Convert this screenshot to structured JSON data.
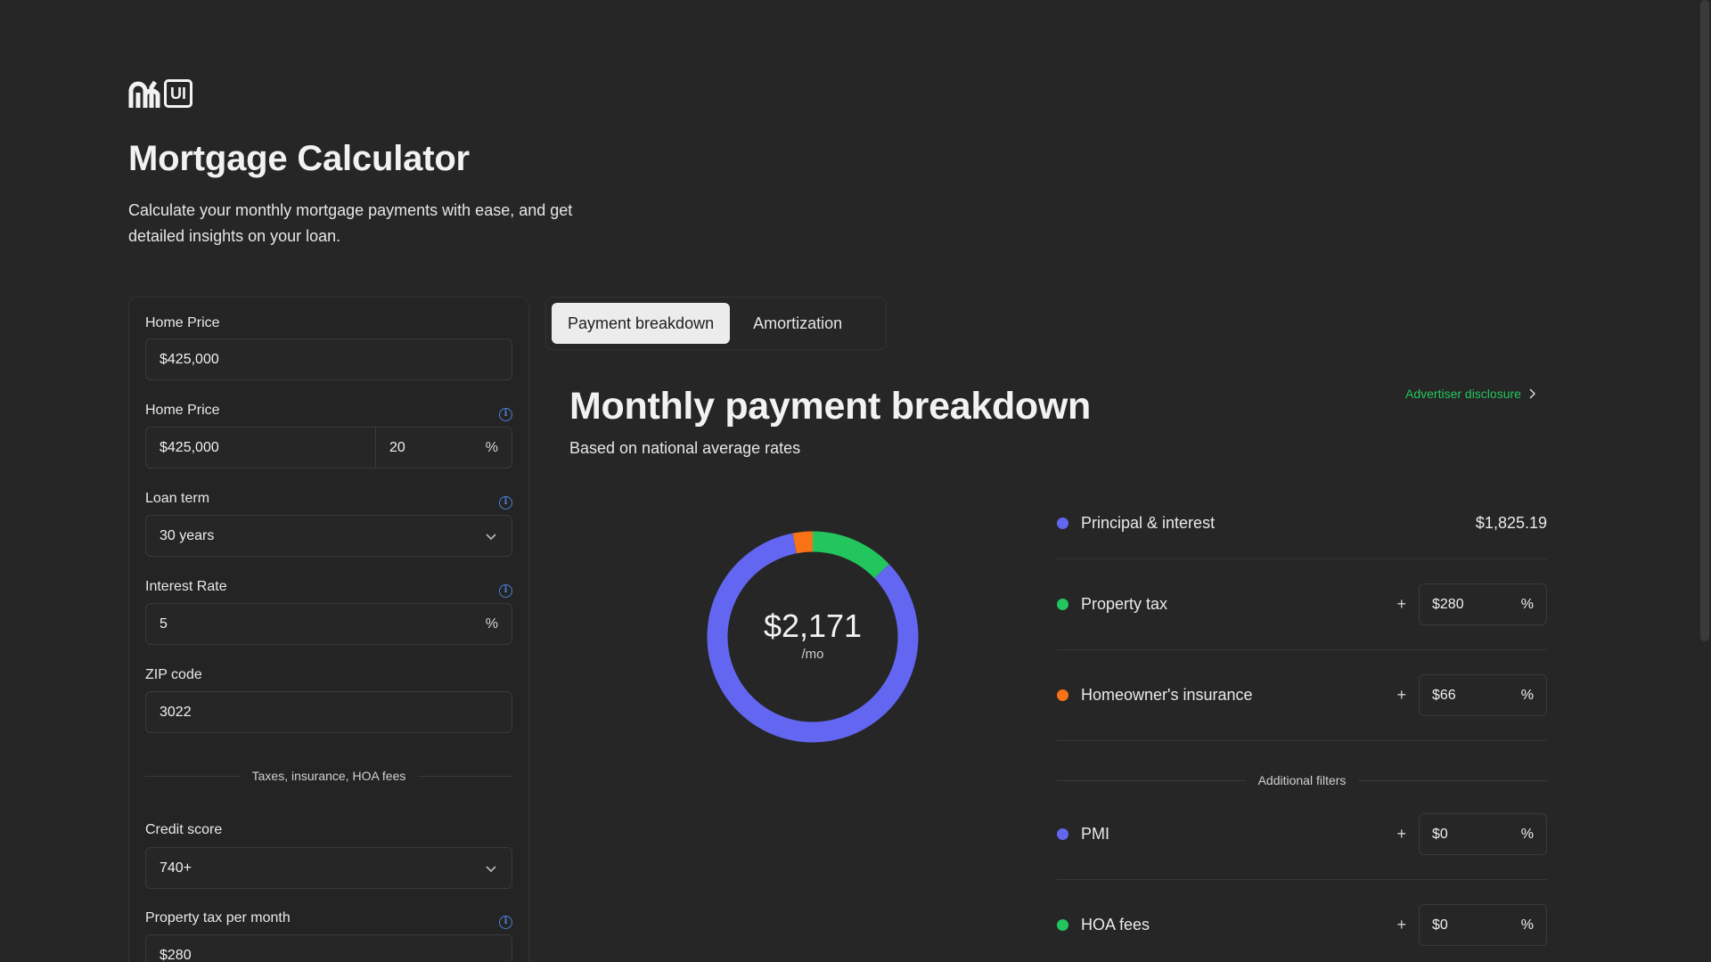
{
  "header": {
    "logo_text": "UI",
    "title": "Mortgage Calculator",
    "subtitle": "Calculate your monthly mortgage payments with ease, and get detailed insights on your loan."
  },
  "form": {
    "home_price": {
      "label": "Home Price",
      "value": "$425,000"
    },
    "down_payment": {
      "label": "Home Price",
      "value": "$425,000",
      "percent": "20",
      "suffix": "%"
    },
    "loan_term": {
      "label": "Loan term",
      "value": "30 years"
    },
    "interest_rate": {
      "label": "Interest Rate",
      "value": "5",
      "suffix": "%"
    },
    "zip": {
      "label": "ZIP code",
      "value": "3022"
    },
    "section_divider": "Taxes, insurance, HOA fees",
    "credit_score": {
      "label": "Credit score",
      "value": "740+"
    },
    "property_tax": {
      "label": "Property tax per month",
      "value": "$280"
    }
  },
  "tabs": [
    {
      "label": "Payment breakdown",
      "active": true
    },
    {
      "label": "Amortization",
      "active": false
    }
  ],
  "breakdown": {
    "title": "Monthly payment breakdown",
    "subtitle": "Based on national average rates",
    "advertiser": "Advertiser disclosure",
    "total": "$2,171",
    "per": "/mo",
    "items": [
      {
        "label": "Principal & interest",
        "amount": "$1,825.19",
        "color": "#6366f1"
      },
      {
        "label": "Property tax",
        "value": "$280",
        "suffix": "%",
        "color": "#22c55e"
      },
      {
        "label": "Homeowner's insurance",
        "value": "$66",
        "suffix": "%",
        "color": "#f97316"
      }
    ],
    "additional_filters": "Additional filters",
    "extra_items": [
      {
        "label": "PMI",
        "value": "$0",
        "suffix": "%",
        "color": "#6366f1"
      },
      {
        "label": "HOA fees",
        "value": "$0",
        "suffix": "%",
        "color": "#22c55e"
      }
    ],
    "plus_sign": "+"
  },
  "chart_data": {
    "type": "pie",
    "categories": [
      "Principal & interest",
      "Property tax",
      "Homeowner's insurance"
    ],
    "values": [
      1825.19,
      280,
      66
    ],
    "colors": [
      "#6366f1",
      "#22c55e",
      "#f97316"
    ],
    "title": ""
  },
  "icons": {
    "info": "info-icon",
    "chevron_down": "chevron-down-icon",
    "chevron_right": "chevron-right-icon"
  }
}
